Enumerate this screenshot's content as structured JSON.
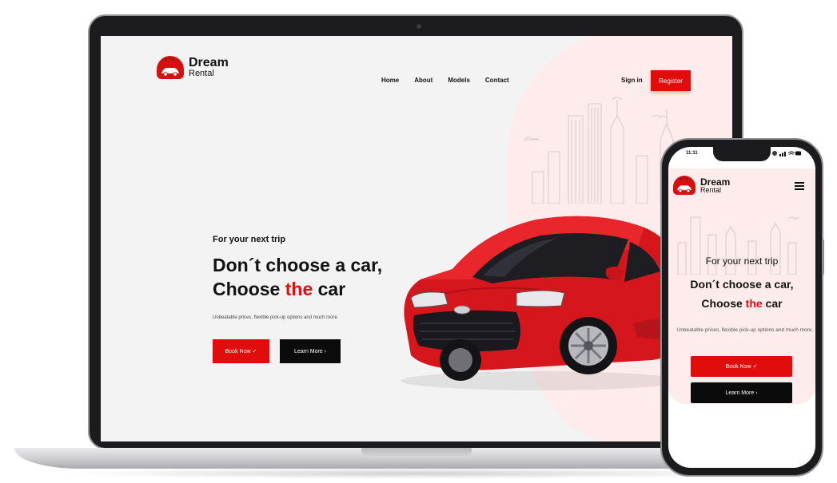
{
  "brand": {
    "name": "Dream",
    "tagline": "Rental"
  },
  "nav": {
    "items": [
      "Home",
      "About",
      "Models",
      "Contact"
    ]
  },
  "header": {
    "signin_label": "Sign in",
    "register_label": "Register"
  },
  "hero": {
    "eyebrow": "For your next trip",
    "line1": "Don´t choose a car,",
    "line2_start": "Choose ",
    "line2_highlight": "the",
    "line2_end": " car",
    "description": "Unbeatable prices, flexible pick-up options and much more.",
    "book_label": "Book Now",
    "book_icon": "✓",
    "learn_label": "Learn More",
    "learn_icon": "›"
  },
  "phone": {
    "status_time": "11:11"
  },
  "colors": {
    "accent": "#e10d0d",
    "dark": "#0b0b0b",
    "blush": "#fdeceb"
  }
}
